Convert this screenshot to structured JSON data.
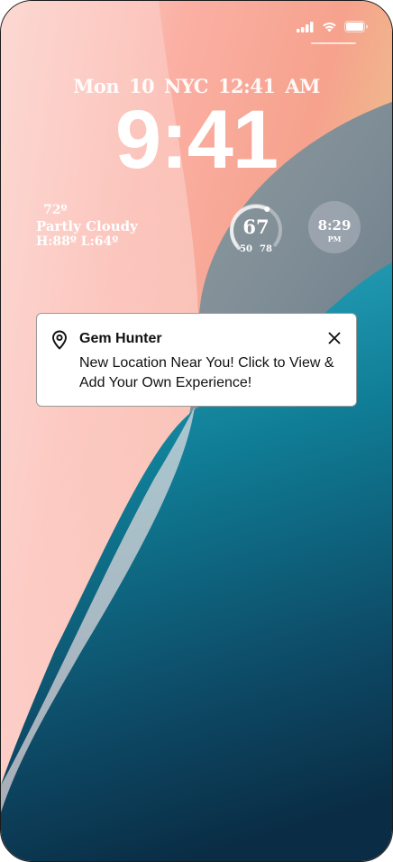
{
  "lock_screen": {
    "date_line": "Mon 10   NYC 12:41 AM",
    "time": "9:41"
  },
  "weather_widget": {
    "temperature": "72º",
    "condition": "Partly Cloudy",
    "high_low": "H:88º L:64º"
  },
  "temp_gauge": {
    "value": "67",
    "low": "50",
    "high": "78",
    "level": 0.6
  },
  "clock_widget": {
    "time": "8:29",
    "ampm": "PM"
  },
  "notification": {
    "app_name": "Gem Hunter",
    "message": "New Location Near You! Click to View & Add Your Own Experience!",
    "icon": "location-pin-icon"
  },
  "colors": {
    "bg_top": "#f7a39a",
    "teal": "#0f7c95",
    "navy": "#0b2a44"
  }
}
